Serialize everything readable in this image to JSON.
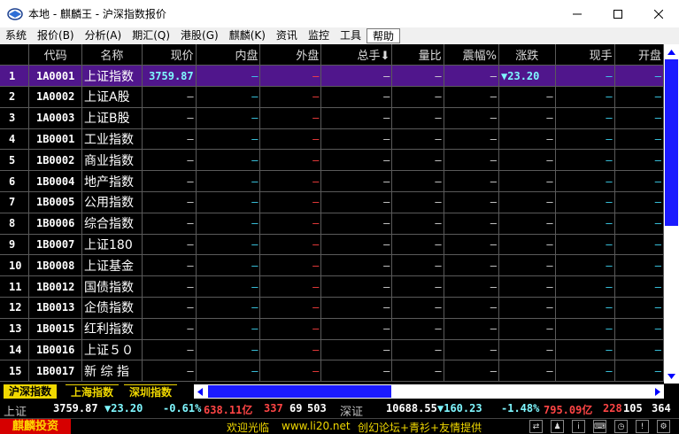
{
  "window": {
    "title": "本地 - 麒麟王 - 沪深指数报价",
    "min_icon": "minimize-icon",
    "max_icon": "maximize-icon",
    "close_icon": "close-icon"
  },
  "menu": [
    "系统",
    "报价(B)",
    "分析(A)",
    "期汇(Q)",
    "港股(G)",
    "麒麟(K)",
    "资讯",
    "监控",
    "工具",
    "帮助"
  ],
  "table": {
    "columns": [
      "",
      "代码",
      "名称",
      "现价",
      "内盘",
      "外盘",
      "总手⬇",
      "量比",
      "震幅%",
      "涨跌",
      "现手",
      "开盘"
    ],
    "rows": [
      {
        "idx": "1",
        "code": "1A0001",
        "name": "上证指数",
        "price": "3759.87",
        "change": "▼23.20",
        "selected": true
      },
      {
        "idx": "2",
        "code": "1A0002",
        "name": "上证A股"
      },
      {
        "idx": "3",
        "code": "1A0003",
        "name": "上证B股"
      },
      {
        "idx": "4",
        "code": "1B0001",
        "name": "工业指数"
      },
      {
        "idx": "5",
        "code": "1B0002",
        "name": "商业指数"
      },
      {
        "idx": "6",
        "code": "1B0004",
        "name": "地产指数"
      },
      {
        "idx": "7",
        "code": "1B0005",
        "name": "公用指数"
      },
      {
        "idx": "8",
        "code": "1B0006",
        "name": "综合指数"
      },
      {
        "idx": "9",
        "code": "1B0007",
        "name": " 上证180"
      },
      {
        "idx": "10",
        "code": "1B0008",
        "name": "上证基金"
      },
      {
        "idx": "11",
        "code": "1B0012",
        "name": "国债指数"
      },
      {
        "idx": "12",
        "code": "1B0013",
        "name": "企债指数"
      },
      {
        "idx": "13",
        "code": "1B0015",
        "name": "红利指数"
      },
      {
        "idx": "14",
        "code": "1B0016",
        "name": "上证５０"
      },
      {
        "idx": "15",
        "code": "1B0017",
        "name": " 新 综 指"
      }
    ],
    "dash": "–"
  },
  "tabs": [
    "沪深指数",
    "上海指数",
    "深圳指数"
  ],
  "status": {
    "sh_label": "上证",
    "sh_price": "3759.87",
    "sh_change": "▼23.20",
    "sh_pct": "-0.61%",
    "sh_amount": "638.11亿",
    "sh_up": "337",
    "sh_down": "69",
    "sh_flat": "503",
    "sz_label": "深证",
    "sz_price": "10688.55",
    "sz_change": "▼160.23",
    "sz_pct": "-1.48%",
    "sz_amount": "795.09亿",
    "sz_up": "228",
    "sz_down": "105",
    "sz_flat": "364"
  },
  "footer": {
    "brand": "麒麟投资",
    "welcome": "欢迎光临",
    "site": "www.li20.net",
    "forum": "创幻论坛+青衫+友情提供"
  },
  "colors": {
    "selected_row": "#50168c",
    "price_cyan": "#7ff7ff",
    "dash_cyan": "#3fd6f4",
    "dash_red": "#ff4040",
    "tab_yellow": "#f0d800",
    "brand_red": "#d60000"
  }
}
